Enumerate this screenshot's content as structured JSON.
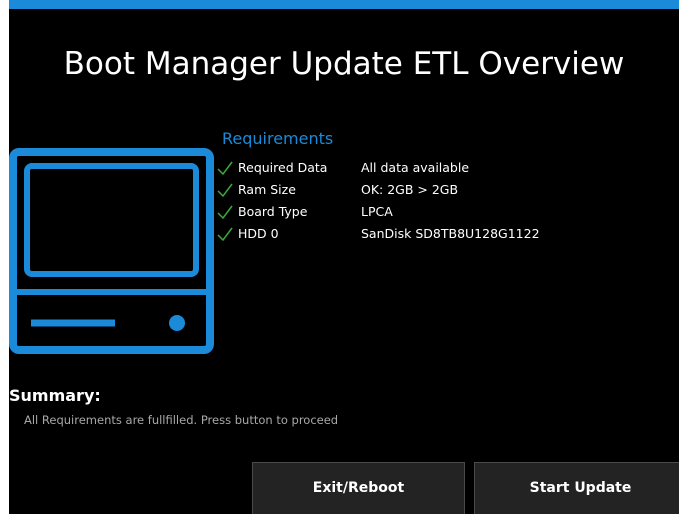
{
  "app": {
    "title": "Boot Manager Update ETL Overview"
  },
  "requirements": {
    "heading": "Requirements",
    "items": [
      {
        "label": "Required Data",
        "value": "All data available",
        "status": "ok"
      },
      {
        "label": "Ram Size",
        "value": "OK: 2GB > 2GB",
        "status": "ok"
      },
      {
        "label": "Board Type",
        "value": "LPCA",
        "status": "ok"
      },
      {
        "label": "HDD 0",
        "value": "SanDisk SD8TB8U128G1122",
        "status": "ok"
      }
    ]
  },
  "summary": {
    "heading": "Summary:",
    "text": "All Requirements are fullfilled. Press button to proceed"
  },
  "buttons": {
    "exit_label": "Exit/Reboot",
    "start_label": "Start Update"
  },
  "icons": {
    "device": "device-icon",
    "check": "check-icon"
  },
  "colors": {
    "accent": "#1b8ad8",
    "check": "#3aa83a",
    "background": "#000000"
  }
}
